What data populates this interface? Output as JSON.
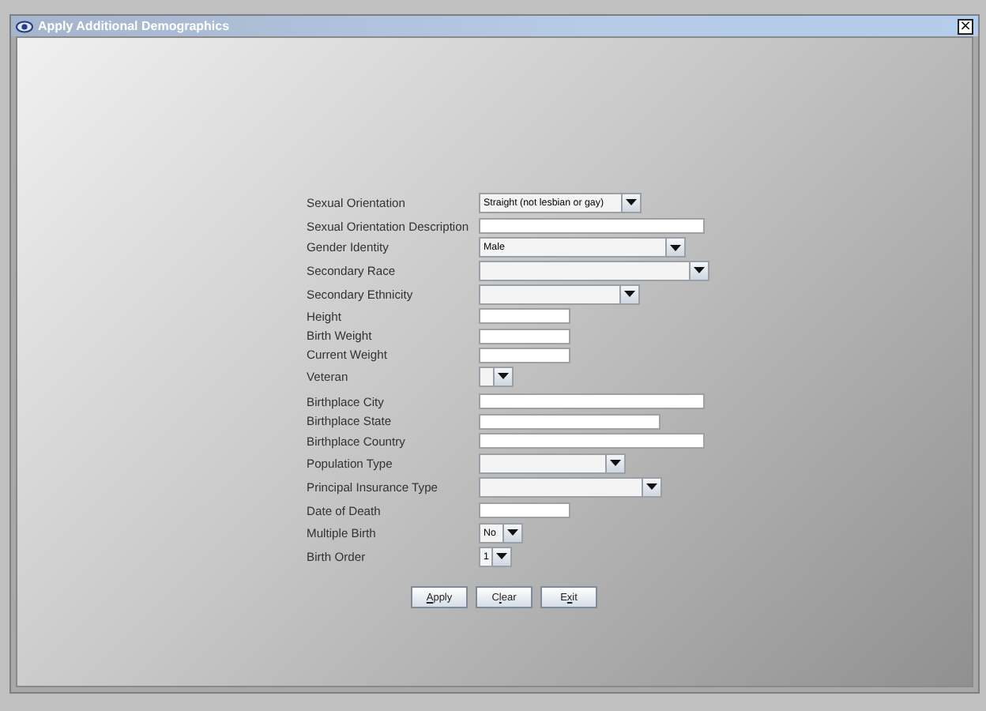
{
  "window": {
    "title": "Apply Additional Demographics",
    "close": "×"
  },
  "fields": [
    {
      "label": "Sexual Orientation",
      "kind": "combo",
      "value": "Straight (not lesbian or gay)"
    },
    {
      "label": "Sexual Orientation Description",
      "kind": "text"
    },
    {
      "label": "Gender Identity",
      "kind": "combo",
      "value": "Male"
    },
    {
      "label": "Secondary Race",
      "kind": "combo"
    },
    {
      "label": "Secondary Ethnicity",
      "kind": "combo"
    },
    {
      "label": "Height",
      "kind": "text"
    },
    {
      "label": "Birth Weight",
      "kind": "text"
    },
    {
      "label": "Current Weight",
      "kind": "text"
    },
    {
      "label": "Veteran",
      "kind": "combo"
    },
    {
      "label": "Birthplace City",
      "kind": "text"
    },
    {
      "label": "Birthplace State",
      "kind": "text"
    },
    {
      "label": "Birthplace Country",
      "kind": "text"
    },
    {
      "label": "Population Type",
      "kind": "combo"
    },
    {
      "label": "Principal Insurance Type",
      "kind": "combo"
    },
    {
      "label": "Date of Death",
      "kind": "text"
    },
    {
      "label": "Multiple Birth",
      "kind": "combo",
      "value": "No"
    },
    {
      "label": "Birth Order",
      "kind": "combo",
      "value": "1"
    }
  ],
  "buttons": [
    {
      "key": "A",
      "rest": "pply"
    },
    {
      "lead": "C",
      "key": "l",
      "rest": "ear"
    },
    {
      "lead": "E",
      "key": "x",
      "rest": "it"
    }
  ]
}
